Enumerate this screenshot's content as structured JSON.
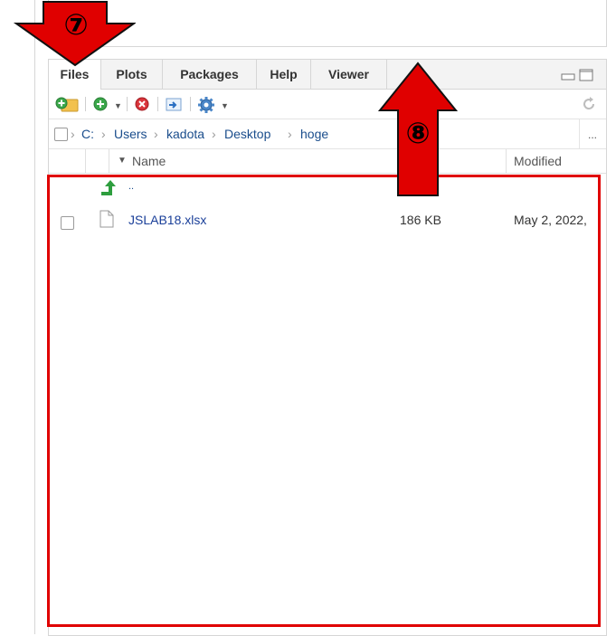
{
  "tabs": [
    {
      "label": "Files",
      "active": true
    },
    {
      "label": "Plots",
      "active": false
    },
    {
      "label": "Packages",
      "active": false
    },
    {
      "label": "Help",
      "active": false
    },
    {
      "label": "Viewer",
      "active": false
    }
  ],
  "toolbar": {
    "new_folder_icon": "new-folder-icon",
    "new_blank_file_icon": "new-blank-file-icon",
    "delete_icon": "delete-icon",
    "rename_icon": "rename-icon",
    "more_icon": "gear-icon",
    "refresh_icon": "refresh-icon"
  },
  "path": {
    "crumbs": [
      "C:",
      "Users",
      "kadota",
      "Desktop",
      "hoge"
    ],
    "more_label": "..."
  },
  "columns": {
    "name": "Name",
    "modified": "Modified"
  },
  "rows": [
    {
      "name": "..",
      "type": "parent",
      "size": "",
      "modified": ""
    },
    {
      "name": "JSLAB18.xlsx",
      "type": "file",
      "size": "186 KB",
      "modified": "May 2, 2022,"
    }
  ],
  "annotations": {
    "step7": "⑦",
    "step8": "⑧"
  },
  "colors": {
    "accent_red": "#e00000",
    "link_blue": "#1a4d8c"
  }
}
